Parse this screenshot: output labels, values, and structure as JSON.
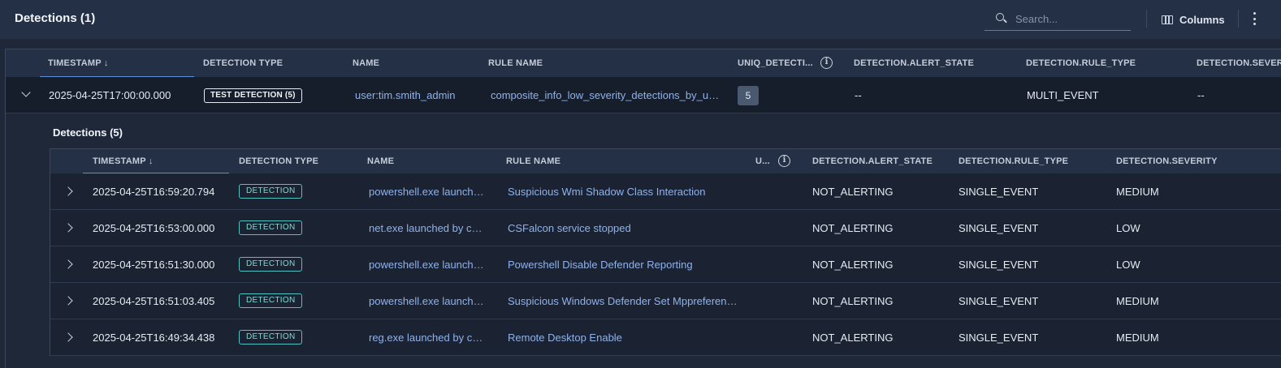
{
  "header": {
    "title": "Detections (1)",
    "search_placeholder": "Search...",
    "columns_label": "Columns"
  },
  "table": {
    "columns": [
      "TIMESTAMP ↓",
      "DETECTION TYPE",
      "NAME",
      "RULE NAME",
      "UNIQ_DETECTI...",
      "DETECTION.ALERT_STATE",
      "DETECTION.RULE_TYPE",
      "DETECTION.SEVERITY"
    ],
    "row": {
      "timestamp": "2025-04-25T17:00:00.000",
      "detection_type": "TEST DETECTION (5)",
      "name": "user:tim.smith_admin",
      "rule_name": "composite_info_low_severity_detections_by_user",
      "uniq_detections": "5",
      "alert_state": "--",
      "rule_type": "MULTI_EVENT",
      "severity": "--"
    }
  },
  "detections": {
    "title": "Detections (5)",
    "columns": [
      "TIMESTAMP ↓",
      "DETECTION TYPE",
      "NAME",
      "RULE NAME",
      "U...",
      "DETECTION.ALERT_STATE",
      "DETECTION.RULE_TYPE",
      "DETECTION.SEVERITY"
    ],
    "rows": [
      {
        "timestamp": "2025-04-25T16:59:20.794",
        "type": "DETECTION",
        "name": "powershell.exe launched by wmiprvse.exe",
        "rule_name": "Suspicious Wmi Shadow Class Interaction",
        "alert_state": "NOT_ALERTING",
        "rule_type": "SINGLE_EVENT",
        "severity": "MEDIUM"
      },
      {
        "timestamp": "2025-04-25T16:53:00.000",
        "type": "DETECTION",
        "name": "net.exe launched by cmd.exe",
        "rule_name": "CSFalcon service stopped",
        "alert_state": "NOT_ALERTING",
        "rule_type": "SINGLE_EVENT",
        "severity": "LOW"
      },
      {
        "timestamp": "2025-04-25T16:51:30.000",
        "type": "DETECTION",
        "name": "powershell.exe launched by cmd.exe",
        "rule_name": "Powershell Disable Defender Reporting",
        "alert_state": "NOT_ALERTING",
        "rule_type": "SINGLE_EVENT",
        "severity": "LOW"
      },
      {
        "timestamp": "2025-04-25T16:51:03.405",
        "type": "DETECTION",
        "name": "powershell.exe launched by cmd.exe",
        "rule_name": "Suspicious Windows Defender Set Mppreference Command",
        "alert_state": "NOT_ALERTING",
        "rule_type": "SINGLE_EVENT",
        "severity": "MEDIUM"
      },
      {
        "timestamp": "2025-04-25T16:49:34.438",
        "type": "DETECTION",
        "name": "reg.exe launched by cmd.exe",
        "rule_name": "Remote Desktop Enable",
        "alert_state": "NOT_ALERTING",
        "rule_type": "SINGLE_EVENT",
        "severity": "MEDIUM"
      }
    ]
  }
}
